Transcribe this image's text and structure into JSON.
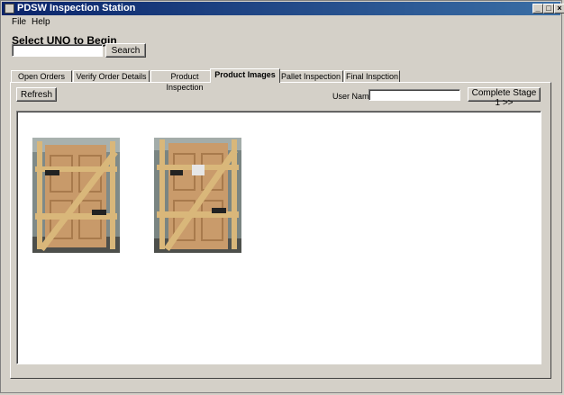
{
  "window": {
    "title": "PDSW Inspection Station"
  },
  "window_controls": {
    "minimize": "_",
    "maximize": "□",
    "close": "×"
  },
  "menu": {
    "file": "File",
    "help": "Help"
  },
  "select": {
    "label": "Select UNQ to Begin",
    "unq_value": "",
    "search_label": "Search"
  },
  "tabs": [
    {
      "label": "Open Orders",
      "active": false
    },
    {
      "label": "Verify Order Details",
      "active": false
    },
    {
      "label": "Product Inspection",
      "active": false
    },
    {
      "label": "Product Images",
      "active": true
    },
    {
      "label": "Pallet Inspection",
      "active": false
    },
    {
      "label": "Final Inspction",
      "active": false
    }
  ],
  "toolbar": {
    "refresh_label": "Refresh",
    "user_name_label": "User Name:",
    "user_name_value": "",
    "complete_label": "Complete Stage 1 >>"
  },
  "images": [
    {
      "icon": "door-on-pallet-photo"
    },
    {
      "icon": "door-on-pallet-photo"
    }
  ],
  "colors": {
    "title_start": "#0a246a",
    "title_end": "#3a6ea5",
    "chrome": "#d4d0c8",
    "door": "#c89a6a",
    "crate_wood": "#d9b77a"
  }
}
